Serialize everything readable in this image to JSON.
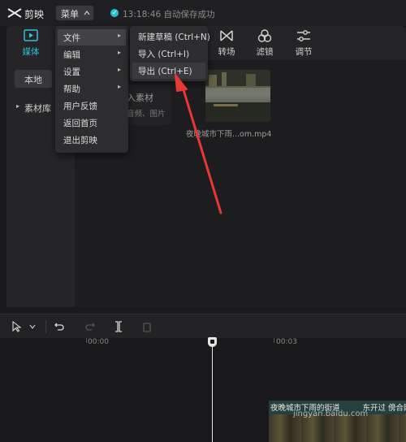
{
  "app": {
    "title": "剪映",
    "menu_label": "菜单",
    "save_status": "13:18:46 自动保存成功"
  },
  "toolbar": {
    "media": "媒体",
    "transition": "转场",
    "filter": "滤镜",
    "adjust": "调节"
  },
  "sidebar": {
    "local_tab": "本地",
    "library": "素材库"
  },
  "media_panel": {
    "import_label": "入素材",
    "import_sub": "音频、图片",
    "clip_name": "夜晚城市下雨...om.mp4"
  },
  "main_menu": [
    {
      "label": "文件",
      "arrow": "▸"
    },
    {
      "label": "编辑",
      "arrow": "▸"
    },
    {
      "label": "设置",
      "arrow": "▸"
    },
    {
      "label": "帮助",
      "arrow": "▸"
    },
    {
      "label": "用户反馈",
      "arrow": ""
    },
    {
      "label": "返回首页",
      "arrow": ""
    },
    {
      "label": "退出剪映",
      "arrow": ""
    }
  ],
  "file_submenu": [
    {
      "label": "新建草稿 (Ctrl+N)"
    },
    {
      "label": "导入 (Ctrl+I)"
    },
    {
      "label": "导出 (Ctrl+E)"
    }
  ],
  "timeline": {
    "ruler": [
      "00:00",
      "00:03"
    ],
    "clip_title": "夜晚城市下雨的街道",
    "clip_title_tail": "东开过  傍合网",
    "watermark": "jingyan.baidu.com"
  },
  "colors": {
    "accent": "#2ec4d8",
    "arrow": "#e53935",
    "save_icon": "#26c0d6"
  }
}
